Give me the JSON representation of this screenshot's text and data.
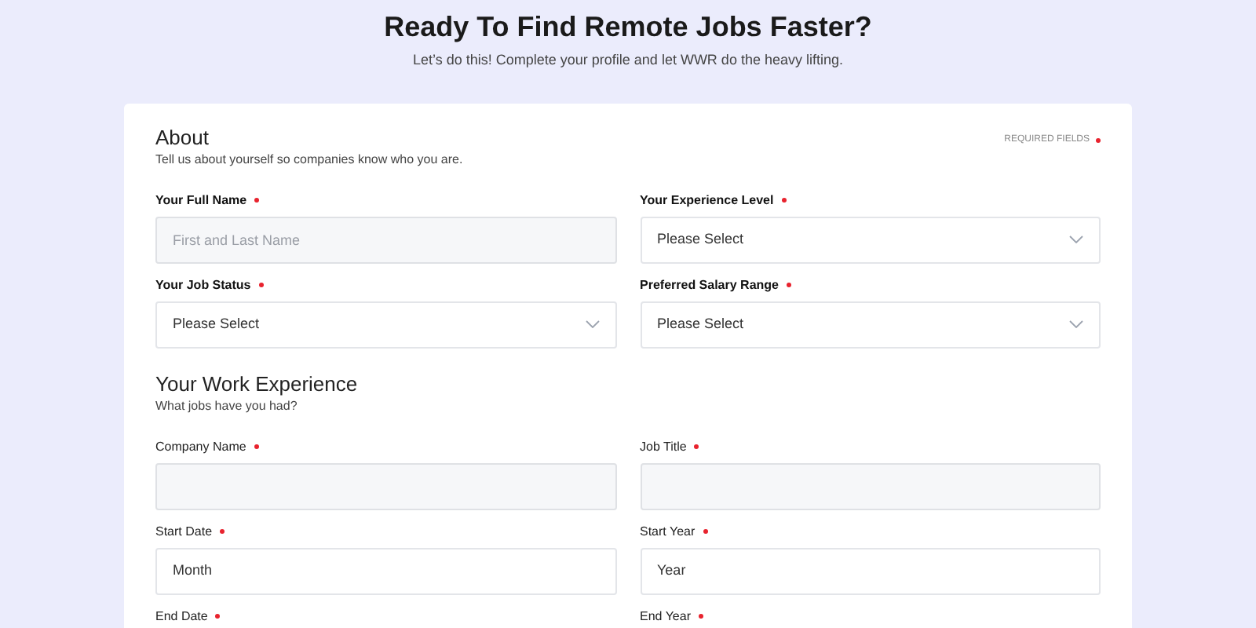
{
  "header": {
    "title": "Ready To Find Remote Jobs Faster?",
    "subtitle": "Let’s do this! Complete your profile and let WWR do the heavy lifting."
  },
  "required_note": "REQUIRED FIELDS",
  "sections": [
    {
      "kind": "about",
      "title": "About",
      "subtitle": "Tell us about yourself so companies know who you are.",
      "fields": [
        {
          "label": "Your Full Name",
          "required": true,
          "kind": "input",
          "placeholder": "First and Last Name"
        },
        {
          "label": "Your Experience Level",
          "required": true,
          "kind": "select",
          "value": "Please Select"
        },
        {
          "label": "Your Job Status",
          "required": true,
          "kind": "select",
          "value": "Please Select"
        },
        {
          "label": "Preferred Salary Range",
          "required": true,
          "kind": "select",
          "value": "Please Select"
        }
      ]
    },
    {
      "kind": "experience",
      "title": "Your Work Experience",
      "subtitle": "What jobs have you had?",
      "fields": [
        {
          "label": "Company Name",
          "required": true,
          "kind": "input"
        },
        {
          "label": "Job Title",
          "required": true,
          "kind": "input"
        },
        {
          "label": "Start Date",
          "required": true,
          "kind": "picker",
          "value": "Month"
        },
        {
          "label": "Start Year",
          "required": true,
          "kind": "picker",
          "value": "Year"
        },
        {
          "label": "End Date",
          "required": true,
          "kind": "none"
        },
        {
          "label": "End Year",
          "required": true,
          "kind": "none"
        }
      ]
    }
  ]
}
